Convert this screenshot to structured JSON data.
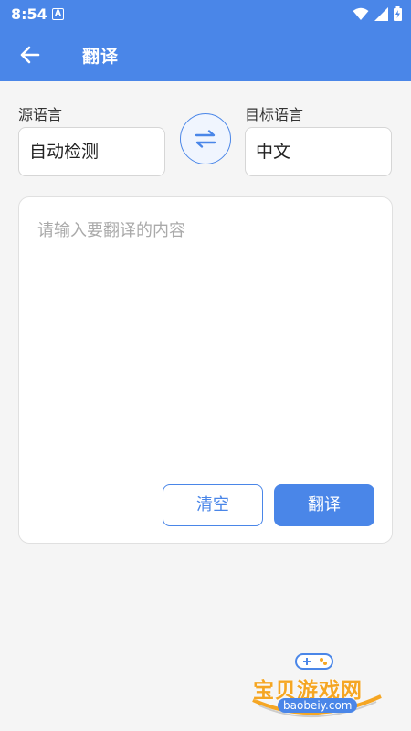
{
  "status_bar": {
    "time": "8:54",
    "notification_icon": "a-icon",
    "right_icons": [
      "wifi-icon",
      "signal-icon",
      "battery-icon"
    ]
  },
  "app_bar": {
    "back_icon": "arrow-left-icon",
    "title": "翻译"
  },
  "source_language": {
    "label": "源语言",
    "value": "自动检测"
  },
  "swap_icon": "swap-arrows-icon",
  "target_language": {
    "label": "目标语言",
    "value": "中文"
  },
  "input": {
    "placeholder": "请输入要翻译的内容",
    "value": ""
  },
  "buttons": {
    "clear_label": "清空",
    "translate_label": "翻译"
  },
  "watermark": {
    "text": "宝贝游戏网",
    "url": "baobeiy.com"
  },
  "colors": {
    "primary": "#4a86e8",
    "background": "#f5f5f5",
    "watermark": "#f5a623"
  }
}
